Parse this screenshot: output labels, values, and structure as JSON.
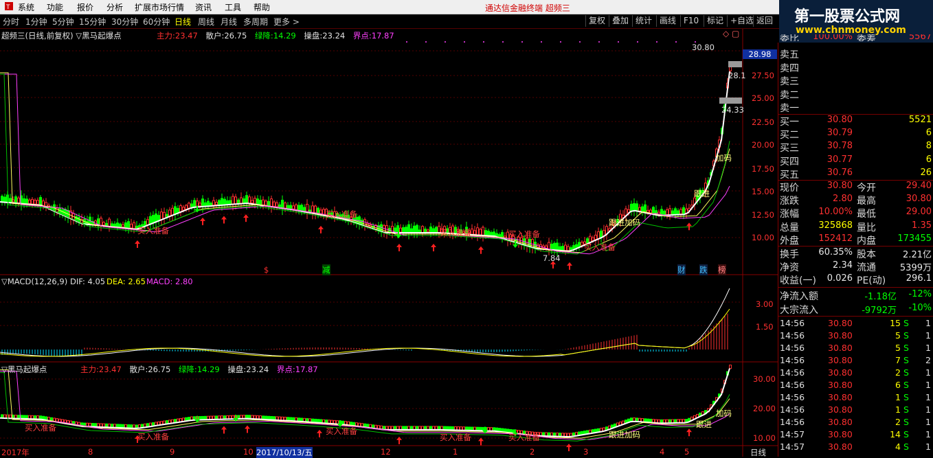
{
  "menu": {
    "items": [
      "系统",
      "功能",
      "报价",
      "分析",
      "扩展市场行情",
      "资讯",
      "工具",
      "帮助"
    ],
    "title": "通达信金融终端  超频三"
  },
  "logo": {
    "line1": "第一股票公式网",
    "line2": "www.chnmoney.com"
  },
  "periods": {
    "items": [
      "分时",
      "1分钟",
      "5分钟",
      "15分钟",
      "30分钟",
      "60分钟",
      "日线",
      "周线",
      "月线",
      "多周期",
      "更多 >"
    ],
    "active": "日线"
  },
  "toolbar": [
    "复权",
    "叠加",
    "统计",
    "画线",
    "F10",
    "标记",
    "+自选",
    "返回"
  ],
  "main_chart": {
    "title": "超频三(日线,前复权)  ▽黑马起爆点",
    "indicators": [
      {
        "label": "主力:",
        "value": "23.47",
        "color": "#ff3030"
      },
      {
        "label": "散户:",
        "value": "26.75",
        "color": "#e0e0e0"
      },
      {
        "label": "绿降:",
        "value": "14.29",
        "color": "#00ff00"
      },
      {
        "label": "操盘:",
        "value": "23.24",
        "color": "#e0e0e0"
      },
      {
        "label": "界点:",
        "value": "17.87",
        "color": "#ff40ff"
      }
    ],
    "y_ticks": [
      "27.50",
      "25.00",
      "22.50",
      "20.00",
      "17.50",
      "15.00",
      "12.50",
      "10.00"
    ],
    "price_box": "28.98",
    "annotations": {
      "high": "30.80",
      "low": "7.84",
      "a1": "28.1",
      "a2": "24.33"
    },
    "signal_labels": [
      "跟进",
      "加码",
      "跟进加码",
      "买入准备"
    ],
    "event_marks": [
      "$",
      "减",
      "财",
      "跌",
      "榜"
    ]
  },
  "macd": {
    "title": "▽MACD(12,26,9)",
    "dif": "DIF: 4.05",
    "dea": "DEA: 2.65",
    "macd": "MACD: 2.80",
    "y_ticks": [
      "3.00",
      "1.50"
    ]
  },
  "sub_chart": {
    "title": "▽黑马起爆点",
    "indicators": [
      {
        "label": "主力:",
        "value": "23.47",
        "color": "#ff3030"
      },
      {
        "label": "散户:",
        "value": "26.75",
        "color": "#e0e0e0"
      },
      {
        "label": "绿降:",
        "value": "14.29",
        "color": "#00ff00"
      },
      {
        "label": "操盘:",
        "value": "23.24",
        "color": "#e0e0e0"
      },
      {
        "label": "界点:",
        "value": "17.87",
        "color": "#ff40ff"
      }
    ],
    "y_ticks": [
      "30.00",
      "20.00",
      "10.00"
    ]
  },
  "x_axis": {
    "labels": [
      "2017年",
      "8",
      "9",
      "10",
      "2017/10/13/五",
      "12",
      "1",
      "2",
      "3",
      "4",
      "5"
    ],
    "period": "日线"
  },
  "quote": {
    "partial_top": {
      "l1": "委比",
      "v1": "100.00%",
      "l2": "委差",
      "v2": "5567"
    },
    "sell": [
      {
        "label": "卖五"
      },
      {
        "label": "卖四"
      },
      {
        "label": "卖三"
      },
      {
        "label": "卖二"
      },
      {
        "label": "卖一"
      }
    ],
    "buy": [
      {
        "label": "买一",
        "price": "30.80",
        "vol": "5521"
      },
      {
        "label": "买二",
        "price": "30.79",
        "vol": "6"
      },
      {
        "label": "买三",
        "price": "30.78",
        "vol": "8"
      },
      {
        "label": "买四",
        "price": "30.77",
        "vol": "6"
      },
      {
        "label": "买五",
        "price": "30.76",
        "vol": "26"
      }
    ],
    "stats": [
      {
        "l1": "现价",
        "v1": "30.80",
        "c1": "red",
        "l2": "今开",
        "v2": "29.40",
        "c2": "red"
      },
      {
        "l1": "涨跌",
        "v1": "2.80",
        "c1": "red",
        "l2": "最高",
        "v2": "30.80",
        "c2": "red"
      },
      {
        "l1": "涨幅",
        "v1": "10.00%",
        "c1": "red",
        "l2": "最低",
        "v2": "29.00",
        "c2": "red"
      },
      {
        "l1": "总量",
        "v1": "325868",
        "c1": "yel",
        "l2": "量比",
        "v2": "1.35",
        "c2": "red"
      },
      {
        "l1": "外盘",
        "v1": "152412",
        "c1": "red",
        "l2": "内盘",
        "v2": "173455",
        "c2": "green"
      }
    ],
    "stats2": [
      {
        "l1": "换手",
        "v1": "60.35%",
        "c1": "white",
        "l2": "股本",
        "v2": "2.21亿",
        "c2": "white"
      },
      {
        "l1": "净资",
        "v1": "2.34",
        "c1": "white",
        "l2": "流通",
        "v2": "5399万",
        "c2": "white"
      },
      {
        "l1": "收益(一)",
        "v1": "0.026",
        "c1": "white",
        "l2": "PE(动)",
        "v2": "296.1",
        "c2": "white"
      }
    ],
    "flows": [
      {
        "label": "净流入额",
        "v1": "-1.18亿",
        "v2": "-12%"
      },
      {
        "label": "大宗流入",
        "v1": "-9792万",
        "v2": "-10%"
      }
    ],
    "ticks": [
      {
        "time": "14:56",
        "price": "30.80",
        "vol": "15",
        "side": "S",
        "n": "1"
      },
      {
        "time": "14:56",
        "price": "30.80",
        "vol": "5",
        "side": "S",
        "n": "1"
      },
      {
        "time": "14:56",
        "price": "30.80",
        "vol": "5",
        "side": "S",
        "n": "1"
      },
      {
        "time": "14:56",
        "price": "30.80",
        "vol": "7",
        "side": "S",
        "n": "2"
      },
      {
        "time": "14:56",
        "price": "30.80",
        "vol": "2",
        "side": "S",
        "n": "1"
      },
      {
        "time": "14:56",
        "price": "30.80",
        "vol": "6",
        "side": "S",
        "n": "1"
      },
      {
        "time": "14:56",
        "price": "30.80",
        "vol": "1",
        "side": "S",
        "n": "1"
      },
      {
        "time": "14:56",
        "price": "30.80",
        "vol": "1",
        "side": "S",
        "n": "1"
      },
      {
        "time": "14:56",
        "price": "30.80",
        "vol": "2",
        "side": "S",
        "n": "1"
      },
      {
        "time": "14:57",
        "price": "30.80",
        "vol": "14",
        "side": "S",
        "n": "1"
      },
      {
        "time": "14:57",
        "price": "30.80",
        "vol": "4",
        "side": "S",
        "n": "1"
      }
    ]
  },
  "colors": {
    "up": "#ff3030",
    "down": "#00ff00",
    "accent": "#ffff00",
    "grid": "#700000"
  }
}
